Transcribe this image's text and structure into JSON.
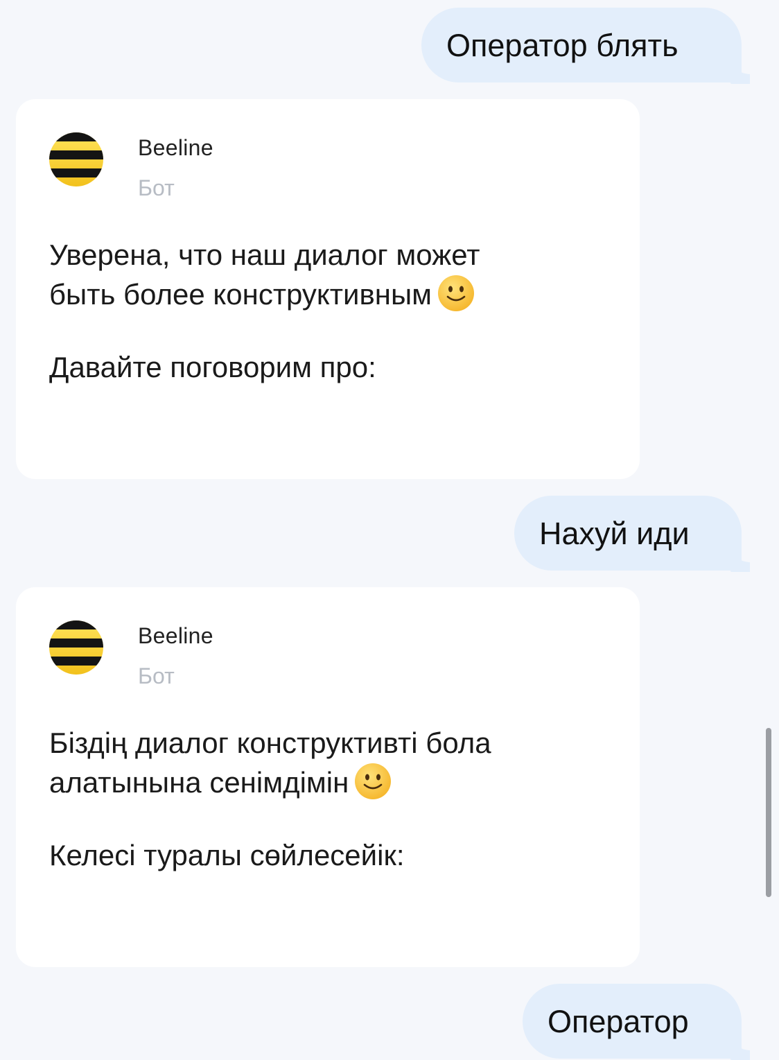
{
  "messages": {
    "user_1": "Оператор блять",
    "bot_1": {
      "name": "Beeline",
      "role": "Бот",
      "line_1": "Уверена, что наш диалог может",
      "line_2": "быть более конструктивным",
      "line_3": "Давайте поговорим про:"
    },
    "user_2": "Нахуй иди",
    "bot_2": {
      "name": "Beeline",
      "role": "Бот",
      "line_1": "Біздің диалог конструктивті бола",
      "line_2": "алатынына сенімдімін",
      "line_3": "Келесі туралы сөйлесейік:"
    },
    "user_3": "Оператор"
  },
  "icons": {
    "avatar": "beeline-logo-icon",
    "emoji": "slightly-smiling-face-icon"
  },
  "colors": {
    "background": "#f5f7fb",
    "user_bubble": "#e3eefb",
    "card": "#ffffff",
    "brand_yellow": "#f7d130",
    "brand_black": "#141414",
    "muted_text": "#b7bcc4"
  }
}
